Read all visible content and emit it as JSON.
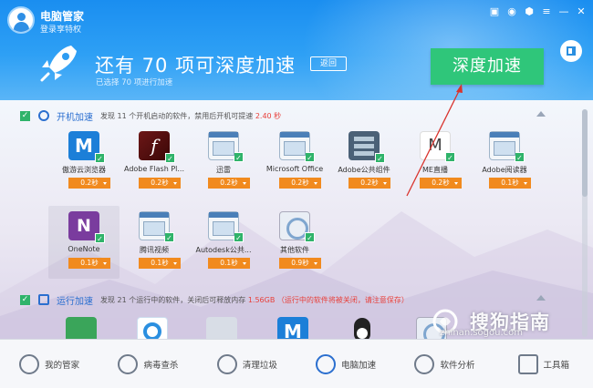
{
  "header": {
    "app_title": "电脑管家",
    "login_link": "登录享特权",
    "headline": "还有 70 项可深度加速",
    "back_label": "返回",
    "sub_note": "已选择 70 项进行加速",
    "accel_button": "深度加速"
  },
  "startup": {
    "title": "开机加速",
    "desc_prefix": "发现 11 个开机启动的软件，禁用后开机可提速",
    "desc_value": "2.40 秒",
    "apps": [
      {
        "name": "傲游云浏览器",
        "time": "0.2秒",
        "icon": "maxthon-icon"
      },
      {
        "name": "Adobe Flash Pl...",
        "time": "0.2秒",
        "icon": "flash-icon"
      },
      {
        "name": "迅雷",
        "time": "0.2秒",
        "icon": "window-icon"
      },
      {
        "name": "Microsoft Office",
        "time": "0.2秒",
        "icon": "window-icon"
      },
      {
        "name": "Adobe公共组件",
        "time": "0.2秒",
        "icon": "server-icon"
      },
      {
        "name": "ME直播",
        "time": "0.2秒",
        "icon": "me-live-icon"
      },
      {
        "name": "Adobe阅读器",
        "time": "0.1秒",
        "icon": "window-icon"
      },
      {
        "name": "OneNote",
        "time": "0.1秒",
        "icon": "onenote-icon"
      },
      {
        "name": "腾讯视频",
        "time": "0.1秒",
        "icon": "window-icon"
      },
      {
        "name": "Autodesk公共...",
        "time": "0.1秒",
        "icon": "window-icon"
      },
      {
        "name": "其他软件",
        "time": "0.9秒",
        "icon": "disc-icon"
      }
    ]
  },
  "running": {
    "title": "运行加速",
    "desc_prefix": "发现 21 个运行中的软件，关闭后可释放内存",
    "desc_value": "1.56GB",
    "desc_warning": "（运行中的软件将被关闭，请注意保存）"
  },
  "bottom_nav": [
    {
      "label": "我的管家",
      "icon": "shield-user-icon"
    },
    {
      "label": "病毒查杀",
      "icon": "virus-scan-icon"
    },
    {
      "label": "清理垃圾",
      "icon": "cleanup-icon"
    },
    {
      "label": "电脑加速",
      "icon": "rocket-icon"
    },
    {
      "label": "软件分析",
      "icon": "software-analysis-icon"
    },
    {
      "label": "工具箱",
      "icon": "toolbox-icon"
    }
  ],
  "watermark": {
    "text": "搜狗指南",
    "url": "zhinan.sogou.com"
  },
  "colors": {
    "header_blue": "#1a8ef0",
    "accel_green": "#2fc67a",
    "badge_orange": "#f18a1e",
    "highlight_red": "#e8403a",
    "link_blue": "#2a6fd0"
  }
}
